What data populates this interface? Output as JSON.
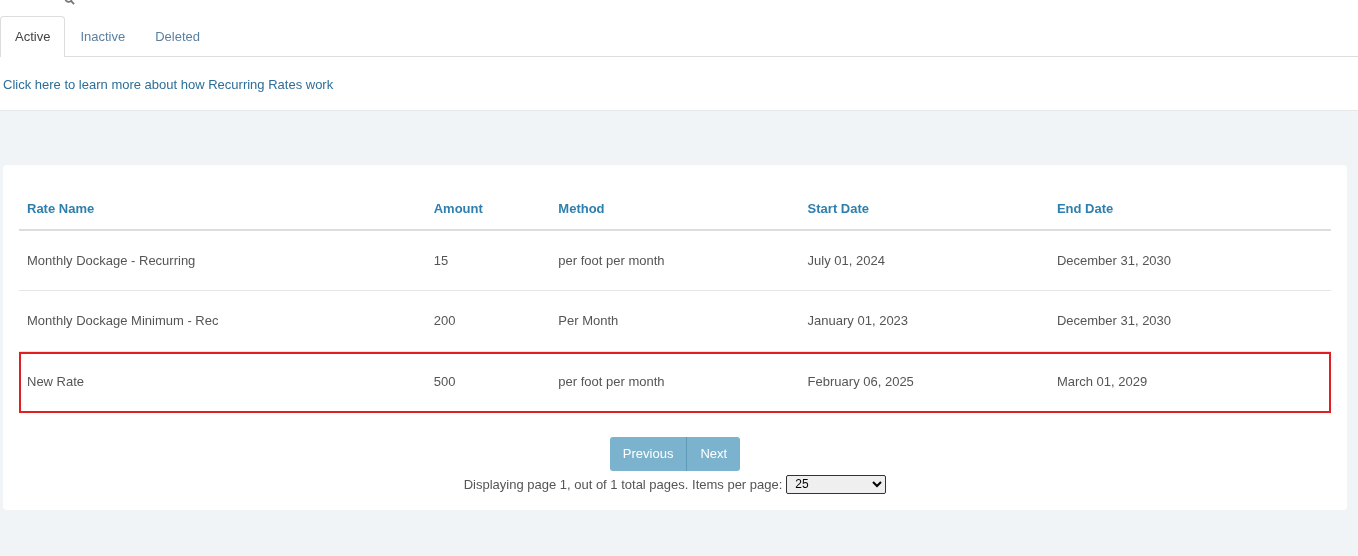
{
  "tabs": [
    {
      "label": "Active",
      "selected": true
    },
    {
      "label": "Inactive",
      "selected": false
    },
    {
      "label": "Deleted",
      "selected": false
    }
  ],
  "help_link": "Click here to learn more about how Recurring Rates work",
  "table": {
    "columns": [
      "Rate Name",
      "Amount",
      "Method",
      "Start Date",
      "End Date"
    ],
    "rows": [
      {
        "cells": [
          "Monthly Dockage - Recurring",
          "15",
          "per foot per month",
          "July 01, 2024",
          "December 31, 2030"
        ],
        "highlighted": false
      },
      {
        "cells": [
          "Monthly Dockage Minimum - Rec",
          "200",
          "Per Month",
          "January 01, 2023",
          "December 31, 2030"
        ],
        "highlighted": false
      },
      {
        "cells": [
          "New Rate",
          "500",
          "per foot per month",
          "February 06, 2025",
          "March 01, 2029"
        ],
        "highlighted": true
      }
    ]
  },
  "pagination": {
    "buttons": [
      {
        "label": "Previous",
        "disabled": true
      },
      {
        "label": "Next",
        "disabled": true
      }
    ],
    "summary": "Displaying page 1, out of 1 total pages. Items per page:",
    "page_size": "25"
  }
}
